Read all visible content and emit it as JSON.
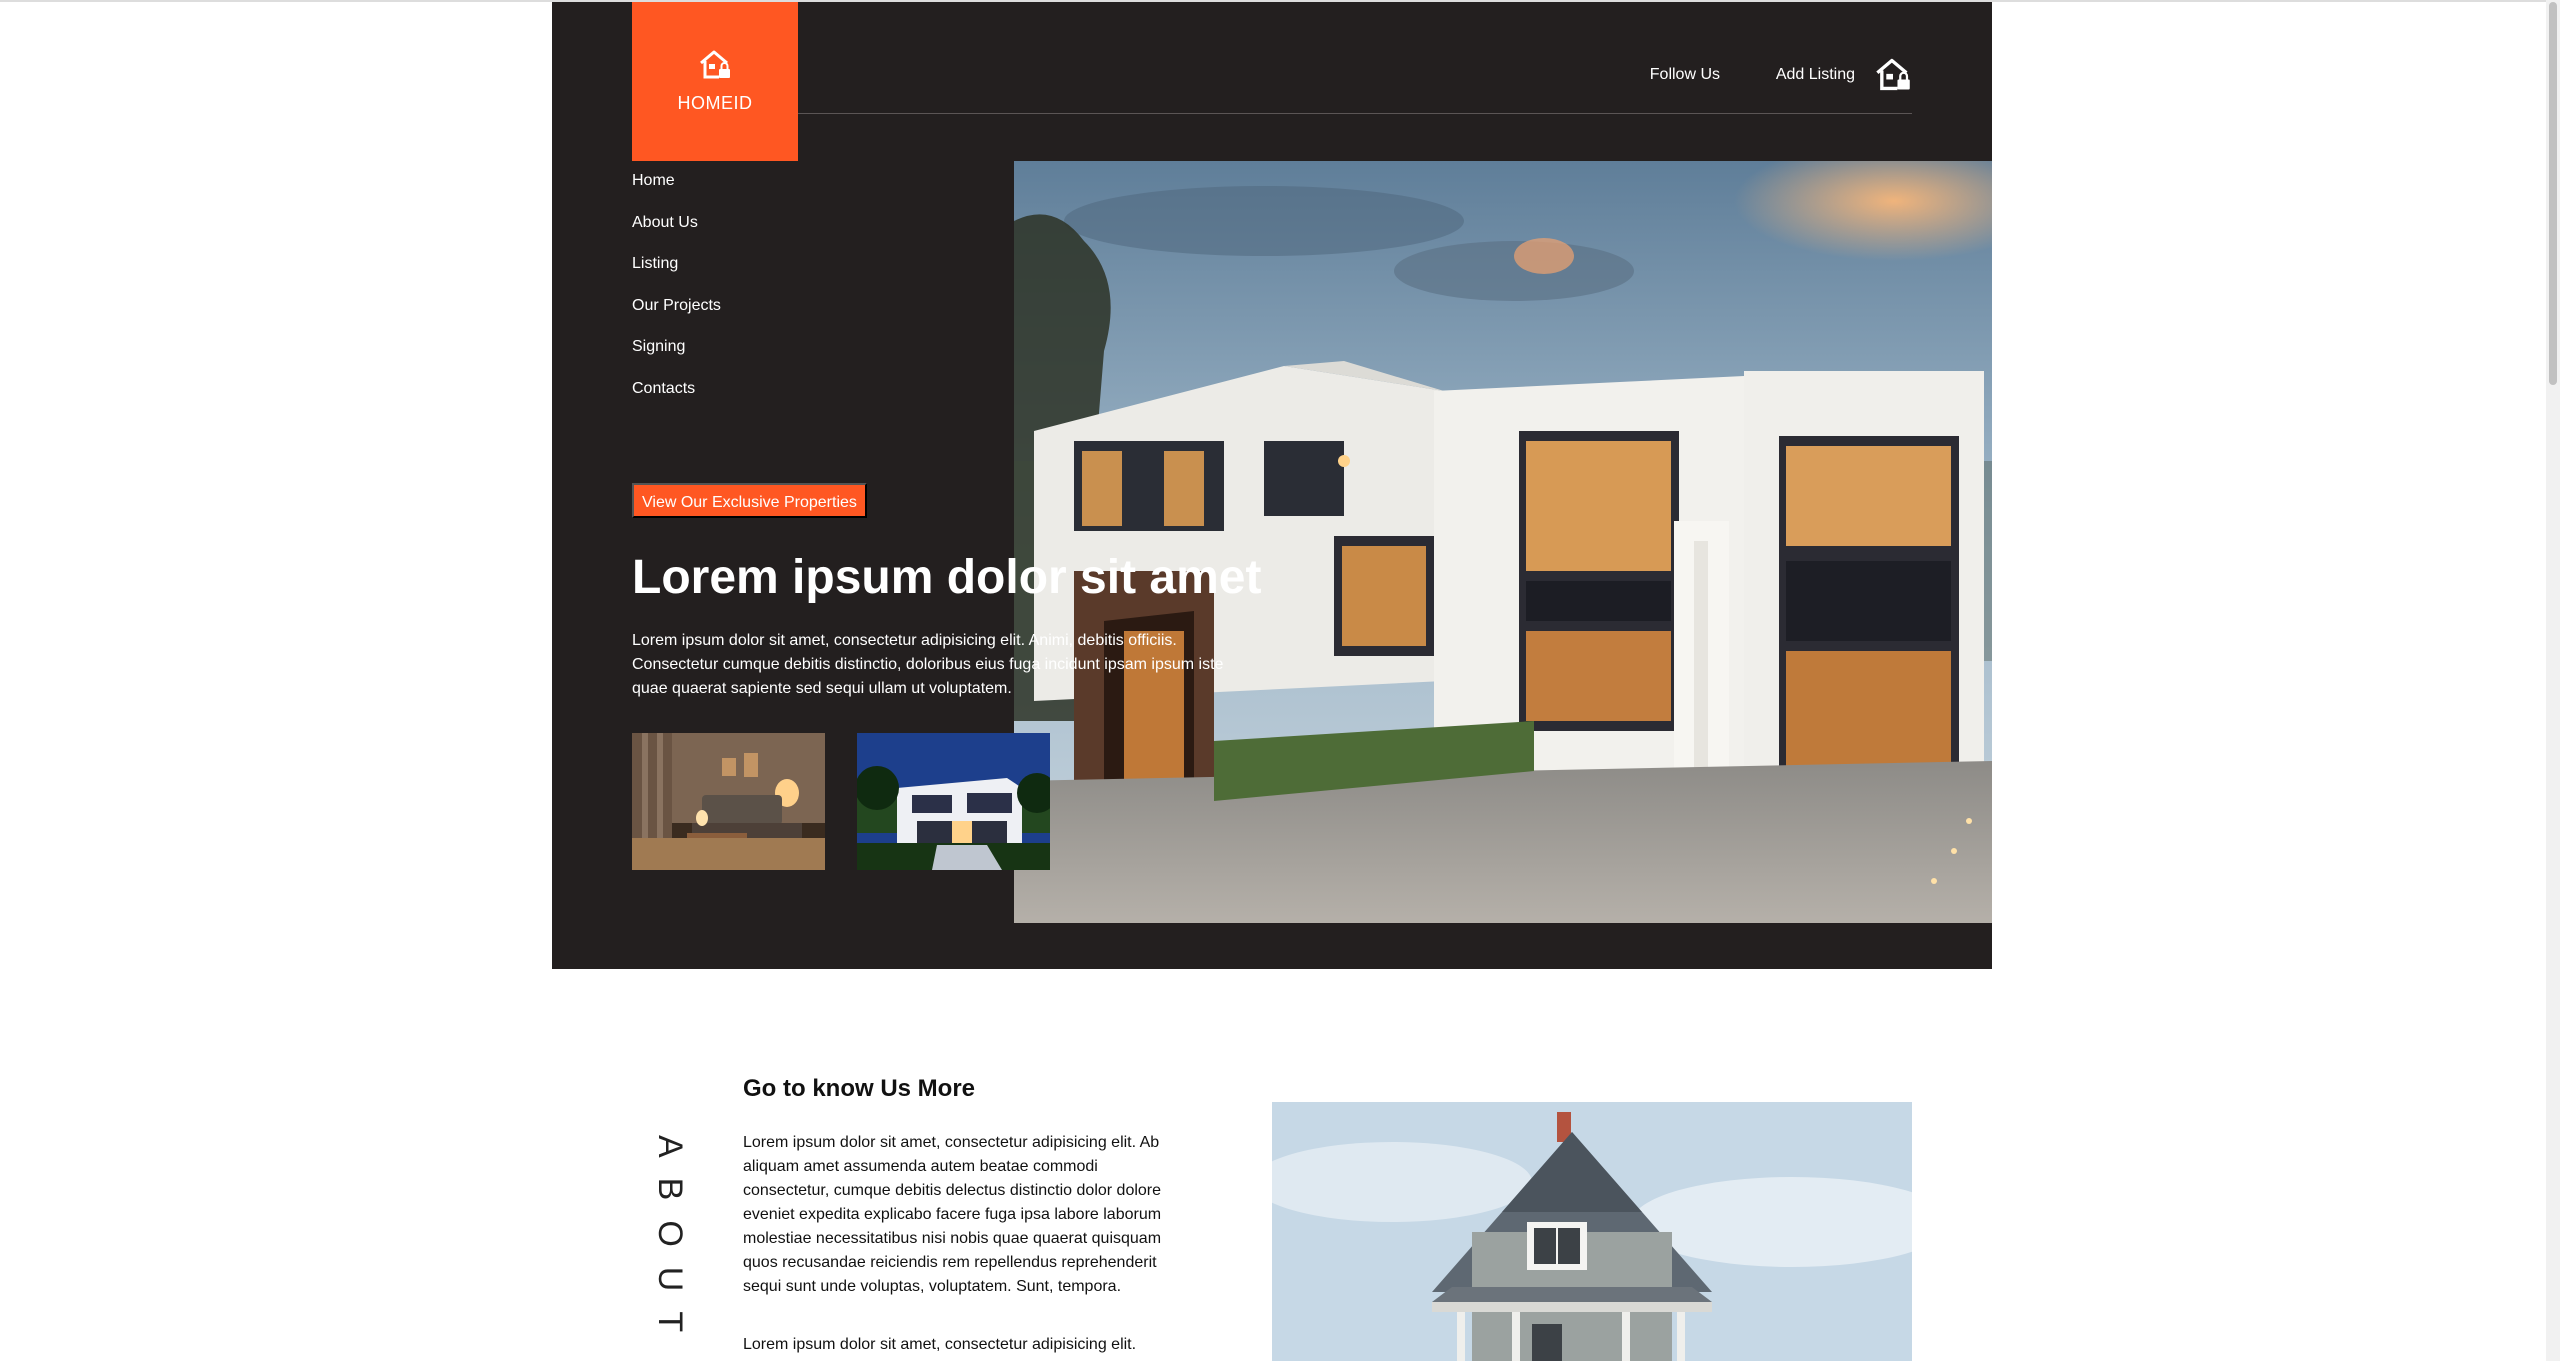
{
  "brand": {
    "name": "HOMEID"
  },
  "topnav": {
    "follow_label": "Follow Us",
    "add_listing_label": "Add Listing"
  },
  "menu": [
    {
      "label": "Home"
    },
    {
      "label": "About Us"
    },
    {
      "label": "Listing"
    },
    {
      "label": "Our Projects"
    },
    {
      "label": "Signing"
    },
    {
      "label": "Contacts"
    }
  ],
  "hero": {
    "cta_label": "View Our Exclusive Properties",
    "headline": "Lorem ipsum dolor sit amet",
    "intro": "Lorem ipsum dolor sit amet, consectetur adipisicing elit. Animi, debitis officiis. Consectetur cumque debitis distinctio, doloribus eius fuga incidunt ipsam ipsum iste quae quaerat sapiente sed sequi ullam ut voluptatem."
  },
  "about": {
    "vertical_label": "ABOUT",
    "title": "Go to know Us More",
    "p1": "Lorem ipsum dolor sit amet, consectetur adipisicing elit. Ab aliquam amet assumenda autem beatae commodi consectetur, cumque debitis delectus distinctio dolor dolore eveniet expedita explicabo facere fuga ipsa labore laborum molestiae necessitatibus nisi nobis quae quaerat quisquam quos recusandae reiciendis rem repellendus reprehenderit sequi sunt unde voluptas, voluptatem. Sunt, tempora.",
    "p2": "Lorem ipsum dolor sit amet, consectetur adipisicing elit."
  },
  "colors": {
    "accent": "#ff5722",
    "hero_bg": "#231f1f",
    "page_bg": "#ffffff"
  },
  "icons": {
    "logo": "house-lock-icon",
    "add_listing": "house-lock-icon"
  }
}
